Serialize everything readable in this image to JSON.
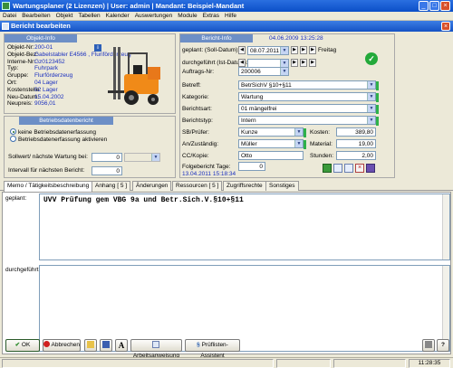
{
  "window": {
    "title": "Wartungsplaner  (2 Lizenzen)  |  User: admin  |  Mandant: Beispiel-Mandant"
  },
  "menu": [
    "Datei",
    "Bearbeiten",
    "Objekt",
    "Tabellen",
    "Kalender",
    "Auswertungen",
    "Module",
    "Extras",
    "Hilfe"
  ],
  "subwindow": {
    "title": "Bericht bearbeiten"
  },
  "objekt": {
    "header": "Objekt-Info",
    "rows": [
      {
        "label": "Objekt-Nr:",
        "value": "200-01"
      },
      {
        "label": "Objekt-Bez:",
        "value": "Gabelstabler E4566 , Fluriförderzeug"
      },
      {
        "label": "Interne-Nr:",
        "value": "Gz0123452"
      },
      {
        "label": "Typ:",
        "value": "Fuhrpark"
      },
      {
        "label": "Gruppe:",
        "value": "Flurförderzeug"
      },
      {
        "label": "Ort:",
        "value": "04 Lager"
      },
      {
        "label": "Kostenstelle:",
        "value": "02 Lager"
      },
      {
        "label": "Neu-Datum:",
        "value": "15.04.2002"
      },
      {
        "label": "Neupreis:",
        "value": "9056,01"
      }
    ]
  },
  "betrieb": {
    "header": "Betriebsdatenbericht",
    "radio_off": "keine Betriebsdatenerfassung",
    "radio_on": "Betriebsdatenerfassung aktivieren",
    "soll_label": "Sollwert/ nächste Wartung bei:",
    "soll_value": "0",
    "interval_label": "Intervall für nächsten Bericht:",
    "interval_value": "0"
  },
  "bericht": {
    "header": "Bericht-Info",
    "header_date": "04.06.2009 13:25:28",
    "geplant_label": "geplant: (Soll-Datum):",
    "geplant_value": "08.07.2011",
    "geplant_day": "Freitag",
    "durchgefuehrt_label": "durchgeführt (Ist-Datum):",
    "auftrag_label": "Auftrags-Nr:",
    "auftrag_value": "200006",
    "betreff_label": "Betreff:",
    "betreff_value": "BetrSichV §10+§11",
    "kategorie_label": "Kategorie:",
    "kategorie_value": "Wartung",
    "berichtsart_label": "Berichtsart:",
    "berichtsart_value": "01 mängelfrei",
    "berichtstyp_label": "Berichtstyp:",
    "berichtstyp_value": "Intern",
    "sb_label": "SB/Prüfer:",
    "sb_value": "Kunze",
    "an_label": "An/Zuständig:",
    "an_value": "Müller",
    "cc_label": "CC/Kopie:",
    "cc_value": "Otto",
    "kosten_label": "Kosten:",
    "kosten_value": "389,80",
    "material_label": "Material:",
    "material_value": "19,00",
    "stunden_label": "Stunden:",
    "stunden_value": "2,00",
    "folge_label": "Folgebericht Tage:",
    "folge_value": "0",
    "folge_date": "13.04.2011 15:18:34"
  },
  "tabs": [
    "Memo / Tätigkeitsbeschreibung",
    "Anhang [ 5 ]",
    "Änderungen",
    "Ressourcen [ 5 ]",
    "Zugriffsrechte",
    "Sonstiges"
  ],
  "memo": {
    "geplant_label": "geplant:",
    "geplant_text": "UVV Prüfung gem VBG 9a und Betr.Sich.V.§10+§11",
    "durchgefuehrt_label": "durchgeführt:"
  },
  "buttons": {
    "ok": "OK",
    "abbrechen": "Abbrechen",
    "arbeitsanweisung": "Arbeitsanweisung",
    "pruefliste": "Prüflisten-Assistent"
  },
  "status": {
    "time": "11:28:35"
  },
  "colors": {
    "title": "#0b4fc8",
    "panel_header": "#6d8fc6",
    "label_blue": "#1a2fbf",
    "required": "#2fb14a"
  }
}
